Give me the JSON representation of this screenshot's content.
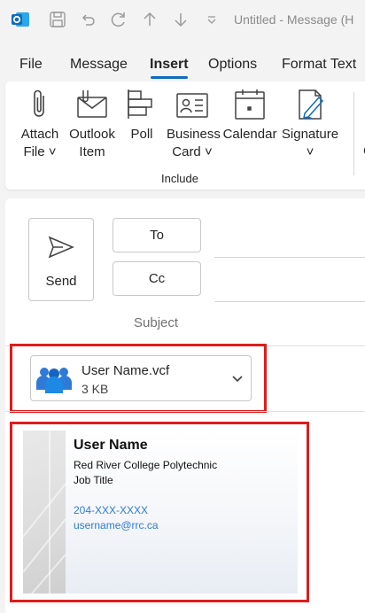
{
  "titlebar": {
    "title": "Untitled  -  Message (H"
  },
  "tabs": [
    "File",
    "Message",
    "Insert",
    "Options",
    "Format Text"
  ],
  "ribbon": {
    "items": [
      {
        "line1": "Attach",
        "line2": "File ˅"
      },
      {
        "line1": "Outlook",
        "line2": "Item"
      },
      {
        "line1": "Poll",
        "line2": ""
      },
      {
        "line1": "Business",
        "line2": "Card ˅"
      },
      {
        "line1": "Calendar",
        "line2": ""
      },
      {
        "line1": "Signature",
        "line2": "˅"
      }
    ],
    "group_label": "Include",
    "cut_text": "C"
  },
  "compose": {
    "send_label": "Send",
    "to_label": "To",
    "cc_label": "Cc",
    "subject_label": "Subject"
  },
  "attachment": {
    "name": "User Name.vcf",
    "size": "3 KB"
  },
  "card": {
    "name": "User Name",
    "org": "Red River College Polytechnic",
    "title": "Job Title",
    "phone": "204-XXX-XXXX",
    "email": "username@rrc.ca"
  },
  "colors": {
    "accent": "#0f6cbd",
    "highlight": "#e01b1b",
    "link": "#2e7bd6"
  }
}
